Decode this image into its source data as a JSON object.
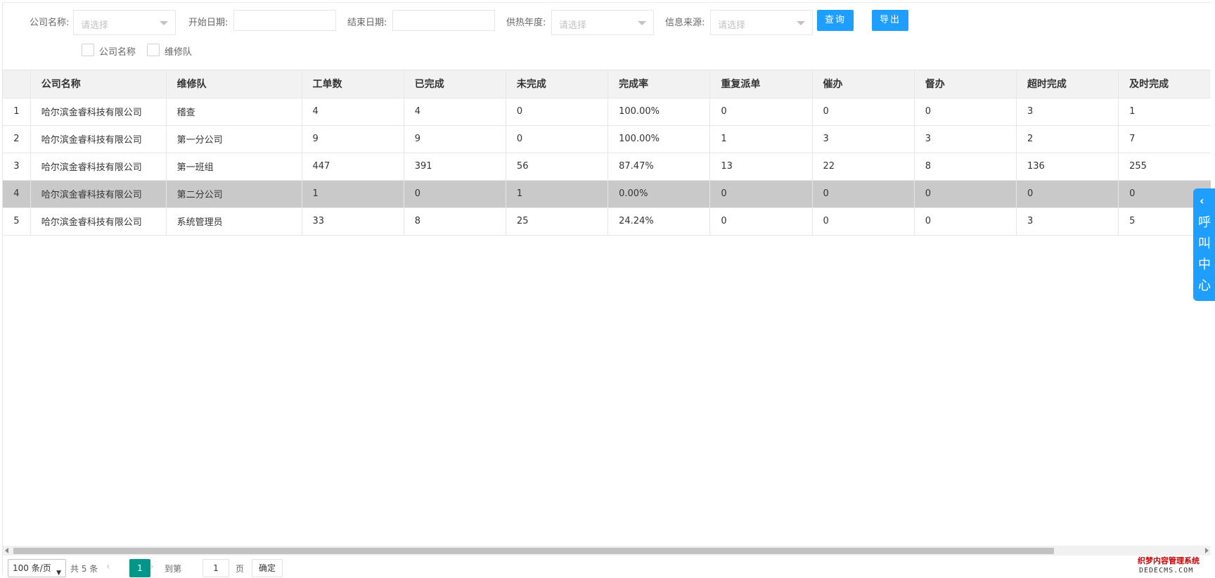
{
  "filters": {
    "company": {
      "label": "公司名称:",
      "placeholder": "请选择"
    },
    "start_date": {
      "label": "开始日期:",
      "value": ""
    },
    "end_date": {
      "label": "结束日期:",
      "value": ""
    },
    "heating_year": {
      "label": "供热年度:",
      "placeholder": "请选择"
    },
    "info_source": {
      "label": "信息来源:",
      "placeholder": "请选择"
    },
    "query_label": "查询",
    "export_label": "导出"
  },
  "group_by": [
    {
      "label": "公司名称",
      "checked": false
    },
    {
      "label": "维修队",
      "checked": false
    }
  ],
  "table": {
    "columns": [
      "",
      "公司名称",
      "维修队",
      "工单数",
      "已完成",
      "未完成",
      "完成率",
      "重复派单",
      "催办",
      "督办",
      "超时完成",
      "及时完成"
    ],
    "rows": [
      [
        "1",
        "哈尔滨金睿科技有限公司",
        "稽查",
        "4",
        "4",
        "0",
        "100.00%",
        "0",
        "0",
        "0",
        "3",
        "1"
      ],
      [
        "2",
        "哈尔滨金睿科技有限公司",
        "第一分公司",
        "9",
        "9",
        "0",
        "100.00%",
        "1",
        "3",
        "3",
        "2",
        "7"
      ],
      [
        "3",
        "哈尔滨金睿科技有限公司",
        "第一班组",
        "447",
        "391",
        "56",
        "87.47%",
        "13",
        "22",
        "8",
        "136",
        "255"
      ],
      [
        "4",
        "哈尔滨金睿科技有限公司",
        "第二分公司",
        "1",
        "0",
        "1",
        "0.00%",
        "0",
        "0",
        "0",
        "0",
        "0"
      ],
      [
        "5",
        "哈尔滨金睿科技有限公司",
        "系统管理员",
        "33",
        "8",
        "25",
        "24.24%",
        "0",
        "0",
        "0",
        "3",
        "5"
      ]
    ],
    "selected_row": 4
  },
  "pager": {
    "page_size": "100 条/页",
    "total": "共 5 条",
    "prev": "‹",
    "current": "1",
    "next": "›",
    "goto_label": "到第",
    "goto_value": "1",
    "page_unit": "页",
    "confirm_label": "确定"
  },
  "side_tab": {
    "label": "呼叫中心",
    "chevron": "‹"
  },
  "watermark": {
    "line1": "织梦内容管理系统",
    "line2": "DEDECMS.COM"
  },
  "colors": {
    "primary": "#1e9fff",
    "pager_active": "#009688",
    "selected_row": "#c9c9c9"
  }
}
